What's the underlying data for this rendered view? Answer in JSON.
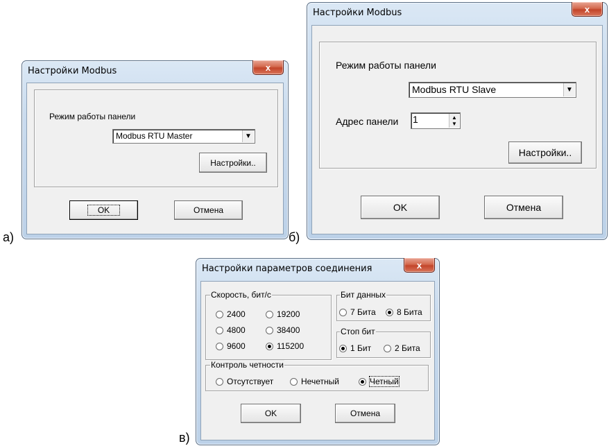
{
  "captions": {
    "a": "а)",
    "b": "б)",
    "c": "в)"
  },
  "dialog_a": {
    "title": "Настройки Modbus",
    "close_glyph": "x",
    "mode_label": "Режим работы панели",
    "mode_value": "Modbus RTU Master",
    "settings_button": "Настройки..",
    "ok_button": "OK",
    "cancel_button": "Отмена"
  },
  "dialog_b": {
    "title": "Настройки Modbus",
    "close_glyph": "x",
    "mode_label": "Режим работы панели",
    "mode_value": "Modbus RTU Slave",
    "address_label": "Адрес панели",
    "address_value": "1",
    "settings_button": "Настройки..",
    "ok_button": "OK",
    "cancel_button": "Отмена"
  },
  "dialog_c": {
    "title": "Настройки параметров соединения",
    "close_glyph": "x",
    "speed_group": "Скорость, бит/с",
    "speeds": [
      "2400",
      "19200",
      "4800",
      "38400",
      "9600",
      "115200"
    ],
    "speed_selected": "115200",
    "data_bits_group": "Бит данных",
    "data_bits": [
      "7 Бита",
      "8 Бита"
    ],
    "data_bits_selected": "8 Бита",
    "stop_bits_group": "Стоп бит",
    "stop_bits": [
      "1 Бит",
      "2 Бита"
    ],
    "stop_bits_selected": "1 Бит",
    "parity_group": "Контроль четности",
    "parity": [
      "Отсутствует",
      "Нечетный",
      "Четный"
    ],
    "parity_selected": "Четный",
    "ok_button": "OK",
    "cancel_button": "Отмена"
  },
  "colors": {
    "client_bg": "#f0f0f0",
    "close_red": "#c3452a",
    "frame_blue": "#bcd1e8"
  },
  "icons": {
    "combo_arrow": "chevron-down-icon",
    "spin": "spin-arrows-icon",
    "close": "close-icon"
  }
}
